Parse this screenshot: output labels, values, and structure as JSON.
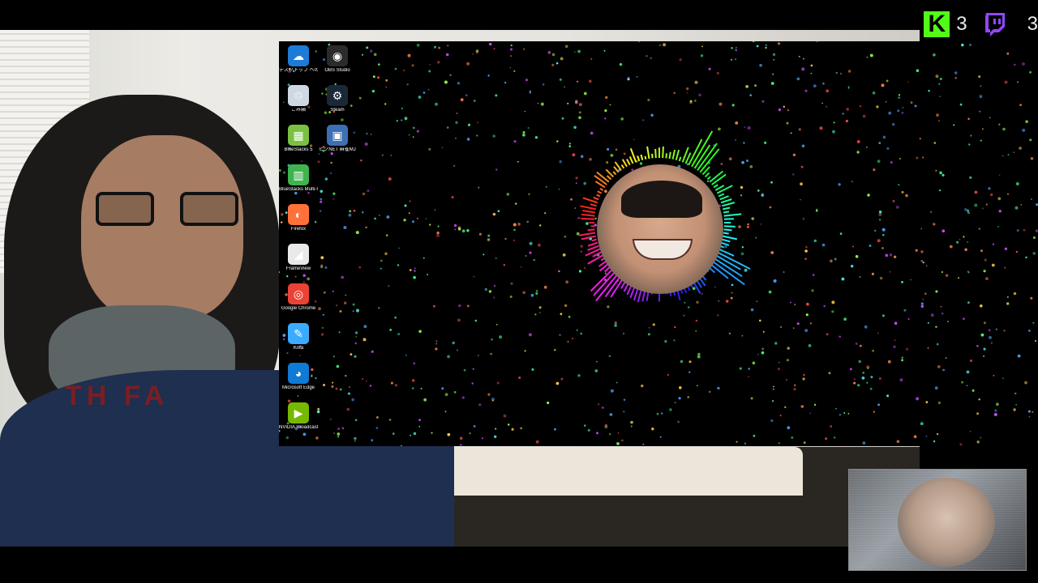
{
  "desktop": {
    "icons": [
      {
        "label": "デスクトップ へのショートカット (OneDri...",
        "icon": "onedrive-icon",
        "color": "#1d7bd8"
      },
      {
        "label": "OBS Studio",
        "icon": "obs-icon",
        "color": "#2b2b2b"
      },
      {
        "label": "ごみ箱",
        "icon": "recycle-bin-icon",
        "color": "#cfd8e2"
      },
      {
        "label": "Steam",
        "icon": "steam-icon",
        "color": "#1b2838"
      },
      {
        "label": "BlueStacks 5",
        "icon": "bluestacks-icon",
        "color": "#7ac143"
      },
      {
        "label": "ピクNET 麻雀MJ",
        "icon": "mahjong-app-icon",
        "color": "#3c6fb4"
      },
      {
        "label": "BlueStacks Multi-Instan...",
        "icon": "bluestacks-multi-icon",
        "color": "#3fb34f"
      },
      {
        "label": "Firefox",
        "icon": "firefox-icon",
        "color": "#ff7139"
      },
      {
        "label": "FrameView",
        "icon": "frameview-icon",
        "color": "#e9e9e9"
      },
      {
        "label": "Google Chrome",
        "icon": "chrome-icon",
        "color": "#ea4335"
      },
      {
        "label": "Krita",
        "icon": "krita-icon",
        "color": "#3babff"
      },
      {
        "label": "Microsoft Edge",
        "icon": "edge-icon",
        "color": "#0f7bd4"
      },
      {
        "label": "NVIDIA Broadcast",
        "icon": "nvidia-broadcast-icon",
        "color": "#76b900"
      }
    ]
  },
  "webcam": {
    "hoodie_text": "TH  FA"
  },
  "counters": {
    "kick_count": "3",
    "twitch_count": "3",
    "kick_color": "#53fc18",
    "twitch_color": "#9146ff"
  }
}
